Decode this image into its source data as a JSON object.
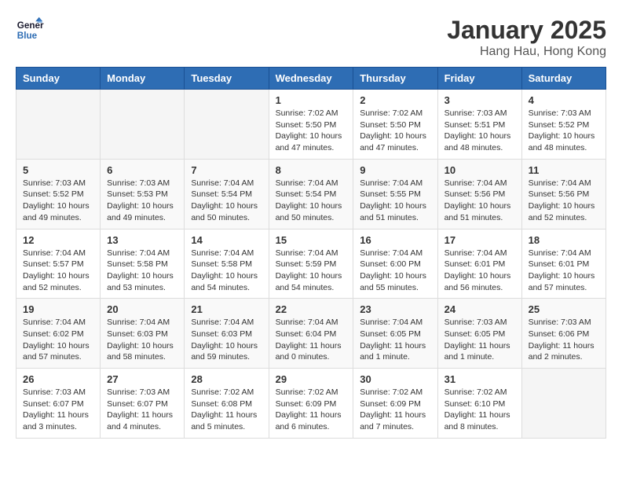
{
  "header": {
    "logo_line1": "General",
    "logo_line2": "Blue",
    "title": "January 2025",
    "subtitle": "Hang Hau, Hong Kong"
  },
  "weekdays": [
    "Sunday",
    "Monday",
    "Tuesday",
    "Wednesday",
    "Thursday",
    "Friday",
    "Saturday"
  ],
  "weeks": [
    [
      {
        "day": "",
        "info": ""
      },
      {
        "day": "",
        "info": ""
      },
      {
        "day": "",
        "info": ""
      },
      {
        "day": "1",
        "info": "Sunrise: 7:02 AM\nSunset: 5:50 PM\nDaylight: 10 hours\nand 47 minutes."
      },
      {
        "day": "2",
        "info": "Sunrise: 7:02 AM\nSunset: 5:50 PM\nDaylight: 10 hours\nand 47 minutes."
      },
      {
        "day": "3",
        "info": "Sunrise: 7:03 AM\nSunset: 5:51 PM\nDaylight: 10 hours\nand 48 minutes."
      },
      {
        "day": "4",
        "info": "Sunrise: 7:03 AM\nSunset: 5:52 PM\nDaylight: 10 hours\nand 48 minutes."
      }
    ],
    [
      {
        "day": "5",
        "info": "Sunrise: 7:03 AM\nSunset: 5:52 PM\nDaylight: 10 hours\nand 49 minutes."
      },
      {
        "day": "6",
        "info": "Sunrise: 7:03 AM\nSunset: 5:53 PM\nDaylight: 10 hours\nand 49 minutes."
      },
      {
        "day": "7",
        "info": "Sunrise: 7:04 AM\nSunset: 5:54 PM\nDaylight: 10 hours\nand 50 minutes."
      },
      {
        "day": "8",
        "info": "Sunrise: 7:04 AM\nSunset: 5:54 PM\nDaylight: 10 hours\nand 50 minutes."
      },
      {
        "day": "9",
        "info": "Sunrise: 7:04 AM\nSunset: 5:55 PM\nDaylight: 10 hours\nand 51 minutes."
      },
      {
        "day": "10",
        "info": "Sunrise: 7:04 AM\nSunset: 5:56 PM\nDaylight: 10 hours\nand 51 minutes."
      },
      {
        "day": "11",
        "info": "Sunrise: 7:04 AM\nSunset: 5:56 PM\nDaylight: 10 hours\nand 52 minutes."
      }
    ],
    [
      {
        "day": "12",
        "info": "Sunrise: 7:04 AM\nSunset: 5:57 PM\nDaylight: 10 hours\nand 52 minutes."
      },
      {
        "day": "13",
        "info": "Sunrise: 7:04 AM\nSunset: 5:58 PM\nDaylight: 10 hours\nand 53 minutes."
      },
      {
        "day": "14",
        "info": "Sunrise: 7:04 AM\nSunset: 5:58 PM\nDaylight: 10 hours\nand 54 minutes."
      },
      {
        "day": "15",
        "info": "Sunrise: 7:04 AM\nSunset: 5:59 PM\nDaylight: 10 hours\nand 54 minutes."
      },
      {
        "day": "16",
        "info": "Sunrise: 7:04 AM\nSunset: 6:00 PM\nDaylight: 10 hours\nand 55 minutes."
      },
      {
        "day": "17",
        "info": "Sunrise: 7:04 AM\nSunset: 6:01 PM\nDaylight: 10 hours\nand 56 minutes."
      },
      {
        "day": "18",
        "info": "Sunrise: 7:04 AM\nSunset: 6:01 PM\nDaylight: 10 hours\nand 57 minutes."
      }
    ],
    [
      {
        "day": "19",
        "info": "Sunrise: 7:04 AM\nSunset: 6:02 PM\nDaylight: 10 hours\nand 57 minutes."
      },
      {
        "day": "20",
        "info": "Sunrise: 7:04 AM\nSunset: 6:03 PM\nDaylight: 10 hours\nand 58 minutes."
      },
      {
        "day": "21",
        "info": "Sunrise: 7:04 AM\nSunset: 6:03 PM\nDaylight: 10 hours\nand 59 minutes."
      },
      {
        "day": "22",
        "info": "Sunrise: 7:04 AM\nSunset: 6:04 PM\nDaylight: 11 hours\nand 0 minutes."
      },
      {
        "day": "23",
        "info": "Sunrise: 7:04 AM\nSunset: 6:05 PM\nDaylight: 11 hours\nand 1 minute."
      },
      {
        "day": "24",
        "info": "Sunrise: 7:03 AM\nSunset: 6:05 PM\nDaylight: 11 hours\nand 1 minute."
      },
      {
        "day": "25",
        "info": "Sunrise: 7:03 AM\nSunset: 6:06 PM\nDaylight: 11 hours\nand 2 minutes."
      }
    ],
    [
      {
        "day": "26",
        "info": "Sunrise: 7:03 AM\nSunset: 6:07 PM\nDaylight: 11 hours\nand 3 minutes."
      },
      {
        "day": "27",
        "info": "Sunrise: 7:03 AM\nSunset: 6:07 PM\nDaylight: 11 hours\nand 4 minutes."
      },
      {
        "day": "28",
        "info": "Sunrise: 7:02 AM\nSunset: 6:08 PM\nDaylight: 11 hours\nand 5 minutes."
      },
      {
        "day": "29",
        "info": "Sunrise: 7:02 AM\nSunset: 6:09 PM\nDaylight: 11 hours\nand 6 minutes."
      },
      {
        "day": "30",
        "info": "Sunrise: 7:02 AM\nSunset: 6:09 PM\nDaylight: 11 hours\nand 7 minutes."
      },
      {
        "day": "31",
        "info": "Sunrise: 7:02 AM\nSunset: 6:10 PM\nDaylight: 11 hours\nand 8 minutes."
      },
      {
        "day": "",
        "info": ""
      }
    ]
  ]
}
